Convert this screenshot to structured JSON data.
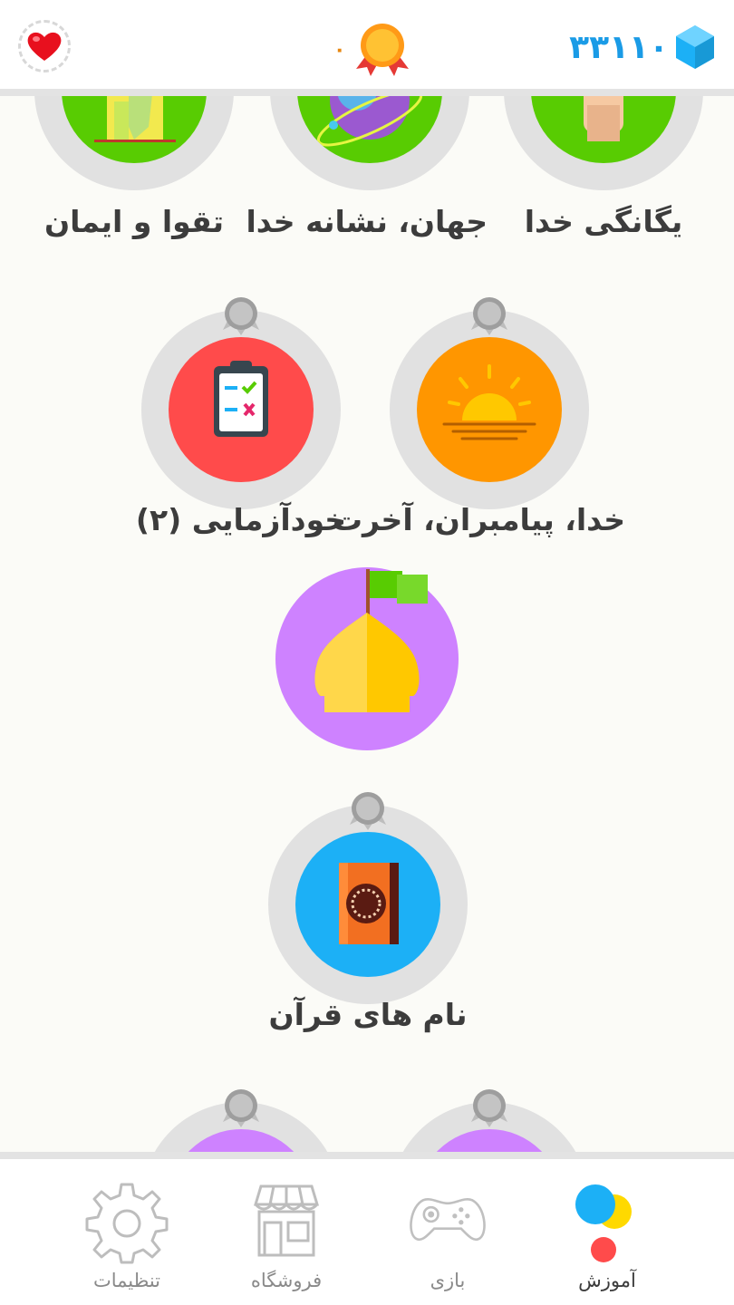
{
  "topbar": {
    "hearts_icon": "heart-icon",
    "medal_count": "۰",
    "medal_icon": "medal-icon",
    "gems_count": "۳۳۱۱۰",
    "gems_icon": "gem-icon",
    "colors": {
      "gems": "#1a9be6",
      "medal": "#e7870f",
      "heart": "#e8101e"
    }
  },
  "lessons": {
    "row1": [
      {
        "label": "یگانگی خدا",
        "icon": "hand-icon",
        "color": "#58cc02"
      },
      {
        "label": "جهان، نشانه خدا",
        "icon": "planet-icon",
        "color": "#58cc02"
      },
      {
        "label": "تقوا و ایمان",
        "icon": "building-icon",
        "color": "#58cc02"
      }
    ],
    "row2": [
      {
        "label": "خدا، پیامبران، آخرت",
        "icon": "sunset-icon",
        "color": "#ff9600"
      },
      {
        "label": "خودآزمایی (۲)",
        "icon": "clipboard-icon",
        "color": "#ff4b4b"
      }
    ],
    "checkpoint": {
      "icon": "dome-flag-icon",
      "color": "#ce82ff"
    },
    "row4": {
      "label": "نام های قرآن",
      "icon": "quran-book-icon",
      "color": "#1cb0f6"
    },
    "row5": [
      {
        "icon": "locked-lesson",
        "color": "#ce82ff"
      },
      {
        "icon": "locked-lesson",
        "color": "#ce82ff"
      }
    ]
  },
  "nav": {
    "learn": "آموزش",
    "game": "بازی",
    "shop": "فروشگاه",
    "settings": "تنظیمات"
  }
}
